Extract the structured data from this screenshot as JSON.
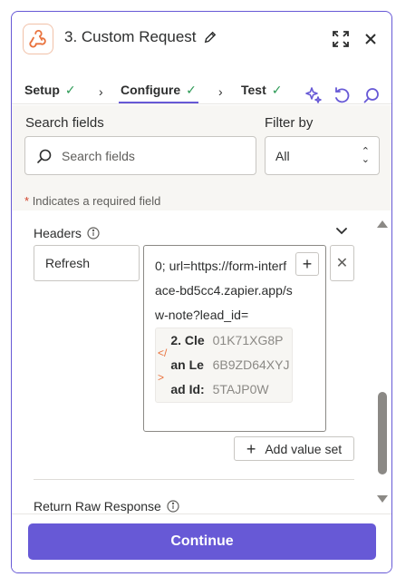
{
  "header": {
    "title": "3. Custom Request",
    "app_icon": "webhook-icon"
  },
  "tabs": [
    {
      "label": "Setup",
      "status": "complete"
    },
    {
      "label": "Configure",
      "status": "complete",
      "active": true
    },
    {
      "label": "Test",
      "status": "complete"
    }
  ],
  "search": {
    "label": "Search fields",
    "placeholder": "Search fields"
  },
  "filter": {
    "label": "Filter by",
    "value": "All"
  },
  "required_note": {
    "star": "*",
    "text": "Indicates a required field"
  },
  "headers_section": {
    "label": "Headers",
    "key": "Refresh",
    "value_prefix": "0; url=https://form-interface-bd5cc4.zapier.app/sw-note?lead_id=",
    "ref_label": "2. Clean Lead Id:",
    "ref_value": "01K71XG8P6B9ZD64XYJ5TAJP0W",
    "add_value_set": "Add value set"
  },
  "return_raw": {
    "label": "Return Raw Response"
  },
  "footer": {
    "continue": "Continue"
  },
  "colors": {
    "accent": "#6759d6",
    "success": "#2c9a55",
    "required": "#d1442d",
    "brand_orange": "#e9723d"
  }
}
